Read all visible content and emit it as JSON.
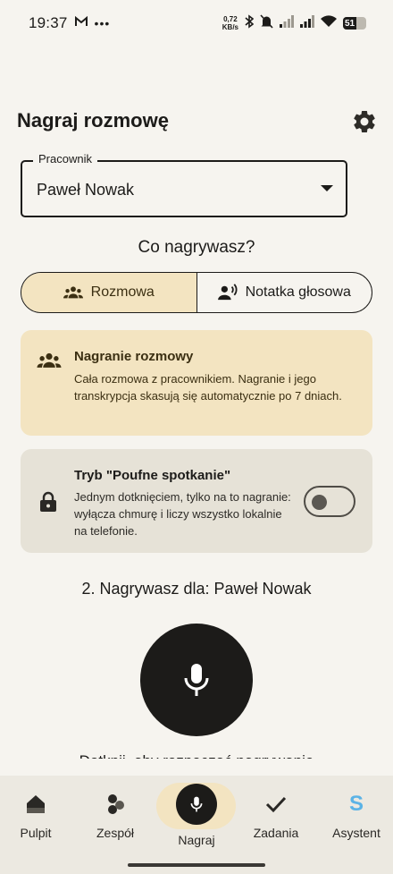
{
  "status_bar": {
    "time": "19:37",
    "net_speed_value": "0,72",
    "net_speed_unit": "KB/s",
    "battery": "51"
  },
  "header": {
    "title": "Nagraj rozmowę"
  },
  "employee_select": {
    "label": "Pracownik",
    "value": "Paweł Nowak"
  },
  "mode": {
    "question": "Co nagrywasz?",
    "options": [
      {
        "label": "Rozmowa",
        "icon": "group-icon",
        "selected": true
      },
      {
        "label": "Notatka głosowa",
        "icon": "voice-note-icon",
        "selected": false
      }
    ]
  },
  "info_card": {
    "title": "Nagranie rozmowy",
    "body": "Cała rozmowa z pracownikiem. Nagranie i jego transkrypcja skasują się automatycznie po 7 dniach."
  },
  "confidential": {
    "title": "Tryb \"Poufne spotkanie\"",
    "body": "Jednym dotknięciem, tylko na to nagranie: wyłącza chmurę i liczy wszystko lokalnie na telefonie.",
    "enabled": false
  },
  "recording": {
    "target": "2. Nagrywasz dla: Paweł Nowak",
    "hint": "Dotknij, aby rozpocząć nagrywanie"
  },
  "nav": {
    "items": [
      {
        "label": "Pulpit",
        "icon": "home-icon"
      },
      {
        "label": "Zespół",
        "icon": "team-icon"
      },
      {
        "label": "Nagraj",
        "icon": "mic-icon",
        "active": true
      },
      {
        "label": "Zadania",
        "icon": "check-icon"
      },
      {
        "label": "Asystent",
        "icon": "assistant-icon"
      }
    ]
  },
  "colors": {
    "background": "#f6f4ef",
    "accent_light": "#f3e4c1",
    "card_gray": "#e6e2d7",
    "dark": "#1c1b19",
    "assistant_blue": "#5bb3e6"
  }
}
